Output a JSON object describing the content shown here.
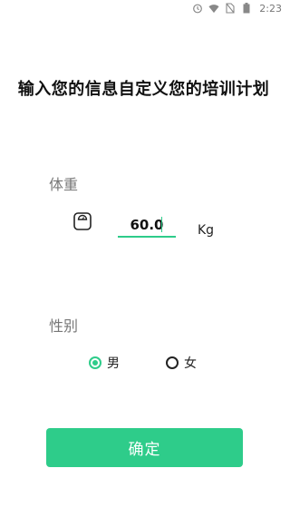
{
  "status_bar": {
    "time": "2:23",
    "icons": [
      "alarm-icon",
      "wifi-icon",
      "no-sim-icon",
      "battery-icon"
    ]
  },
  "title": "输入您的信息自定义您的培训计划",
  "weight": {
    "label": "体重",
    "icon": "scale-icon",
    "value": "60.0",
    "unit": "Kg"
  },
  "gender": {
    "label": "性别",
    "options": [
      {
        "label": "男",
        "selected": true
      },
      {
        "label": "女",
        "selected": false
      }
    ]
  },
  "confirm_button": {
    "label": "确定"
  },
  "colors": {
    "accent": "#2ecc8a",
    "label_gray": "#777777",
    "text_dark": "#111111"
  }
}
